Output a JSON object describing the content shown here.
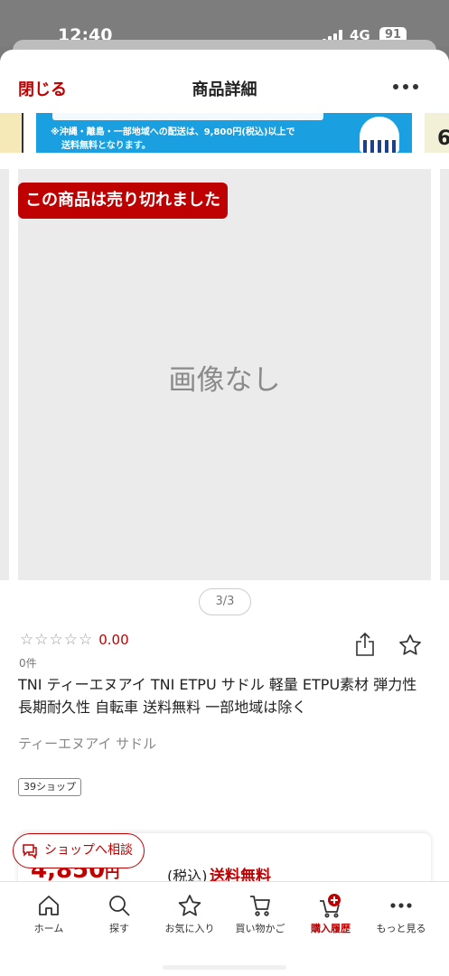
{
  "status_bar": {
    "time": "12:40",
    "network": "4G",
    "battery": "91"
  },
  "header": {
    "close_label": "閉じる",
    "title": "商品詳細"
  },
  "banner": {
    "line1": "※沖縄・離島・一部地域への配送は、9,800円(税込)以上で",
    "line2": "送料無料となります。",
    "right_text": "6"
  },
  "gallery": {
    "soldout_label": "この商品は売り切れました",
    "no_image_label": "画像なし",
    "pager": "3/3"
  },
  "product": {
    "rating_score": "0.00",
    "review_count": "0件",
    "title": "TNI ティーエヌアイ TNI ETPU サドル 軽量 ETPU素材 弾力性 長期耐久性 自転車 送料無料 一部地域は除く",
    "brand": "ティーエヌアイ サドル",
    "shop_tag": "39ショップ",
    "price": "4,850",
    "yen": "円",
    "tax_label": "(税込)",
    "shipping_label": "送料無料"
  },
  "consult_button": {
    "label": "ショップへ相談"
  },
  "tabbar": {
    "items": [
      {
        "label": "ホーム",
        "icon": "home-icon"
      },
      {
        "label": "探す",
        "icon": "search-icon"
      },
      {
        "label": "お気に入り",
        "icon": "star-icon"
      },
      {
        "label": "買い物かご",
        "icon": "cart-icon"
      },
      {
        "label": "購入履歴",
        "icon": "purchase-history-icon"
      },
      {
        "label": "もっと見る",
        "icon": "more-icon"
      }
    ]
  },
  "colors": {
    "accent": "#bf0000",
    "banner": "#1aa0e0"
  }
}
